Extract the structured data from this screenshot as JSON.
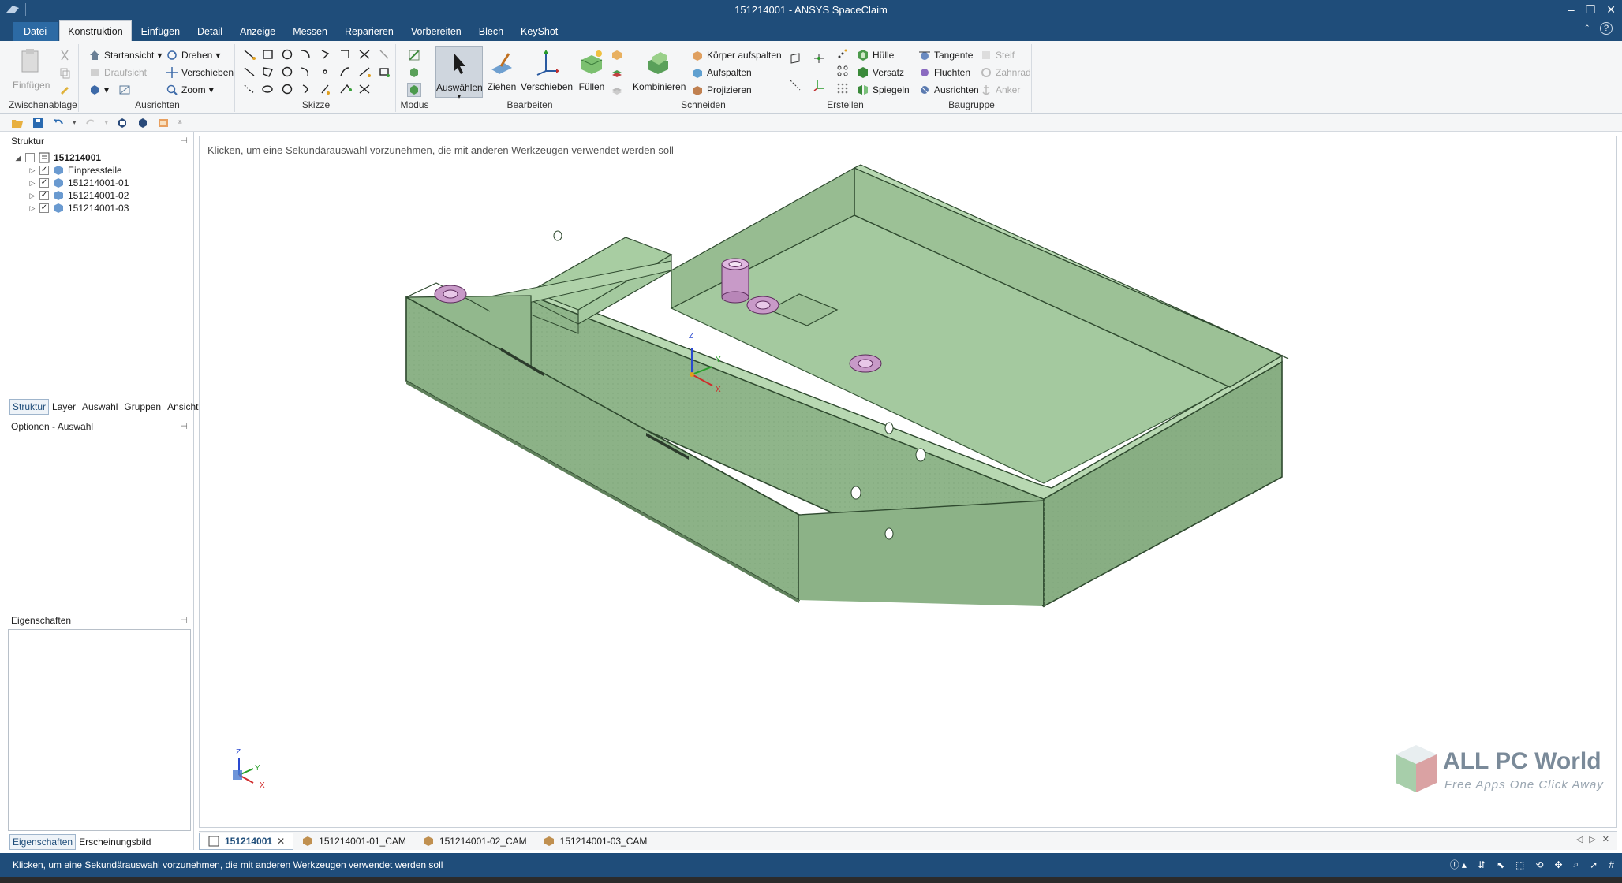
{
  "window": {
    "title": "151214001 - ANSYS SpaceClaim",
    "controls": [
      "–",
      "❐",
      "✕"
    ]
  },
  "menu": {
    "file_tab": "Datei",
    "tabs": [
      "Konstruktion",
      "Einfügen",
      "Detail",
      "Anzeige",
      "Messen",
      "Reparieren",
      "Vorbereiten",
      "Blech",
      "KeyShot"
    ],
    "active_tab": "Konstruktion",
    "right_controls": [
      "ˆ",
      "?"
    ]
  },
  "ribbon": {
    "zwischenablage": {
      "label": "Zwischenablage",
      "einfuegen": "Einfügen"
    },
    "ausrichten": {
      "label": "Ausrichten",
      "startansicht": "Startansicht",
      "draufsicht": "Draufsicht",
      "drehen": "Drehen",
      "verschieben": "Verschieben",
      "zoom": "Zoom"
    },
    "skizze": {
      "label": "Skizze"
    },
    "modus": {
      "label": "Modus"
    },
    "bearbeiten": {
      "label": "Bearbeiten",
      "auswaehlen": "Auswählen",
      "ziehen": "Ziehen",
      "verschieben": "Verschieben",
      "fuellen": "Füllen"
    },
    "schneiden": {
      "label": "Schneiden",
      "kombinieren": "Kombinieren",
      "koerper_aufspalten": "Körper aufspalten",
      "aufspalten": "Aufspalten",
      "projizieren": "Projizieren"
    },
    "erstellen": {
      "label": "Erstellen",
      "huelle": "Hülle",
      "versatz": "Versatz",
      "spiegeln": "Spiegeln"
    },
    "baugruppe": {
      "label": "Baugruppe",
      "tangente": "Tangente",
      "fluchten": "Fluchten",
      "ausrichten": "Ausrichten",
      "steif": "Steif",
      "zahnrad": "Zahnrad",
      "anker": "Anker"
    }
  },
  "structure_panel": {
    "title": "Struktur",
    "tree": [
      {
        "label": "151214001",
        "level": 0,
        "expanded": true,
        "bold": true
      },
      {
        "label": "Einpressteile",
        "level": 1
      },
      {
        "label": "151214001-01",
        "level": 1
      },
      {
        "label": "151214001-02",
        "level": 1
      },
      {
        "label": "151214001-03",
        "level": 1
      }
    ],
    "tabs": [
      "Struktur",
      "Layer",
      "Auswahl",
      "Gruppen",
      "Ansichten"
    ],
    "active_tab": "Struktur"
  },
  "options_panel": {
    "title": "Optionen - Auswahl"
  },
  "properties_panel": {
    "title": "Eigenschaften",
    "tabs": [
      "Eigenschaften",
      "Erscheinungsbild"
    ],
    "active_tab": "Eigenschaften"
  },
  "viewport": {
    "hint": "Klicken, um eine Sekundärauswahl vorzunehmen, die mit anderen Werkzeugen verwendet werden soll",
    "axis_labels": {
      "x": "X",
      "y": "Y",
      "z": "Z"
    },
    "model_color": "#9fc49a"
  },
  "watermark": {
    "title": "ALL PC World",
    "subtitle": "Free Apps One Click Away"
  },
  "document_tabs": [
    "151214001",
    "151214001-01_CAM",
    "151214001-02_CAM",
    "151214001-03_CAM"
  ],
  "active_document": "151214001",
  "statusbar": {
    "message": "Klicken, um eine Sekundärauswahl vorzunehmen, die mit anderen Werkzeugen verwendet werden soll"
  },
  "colors": {
    "chrome": "#1f4d7a",
    "ribbon": "#f5f6f7",
    "accent": "#2c6aa4"
  }
}
